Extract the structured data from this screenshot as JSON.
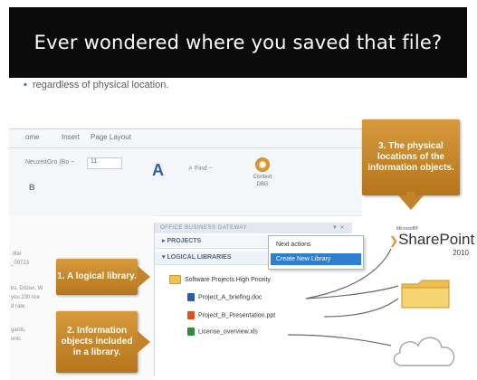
{
  "slide": {
    "title": "Ever wondered where you saved that file?",
    "blurb": "regardless of physical location."
  },
  "ribbon": {
    "tabs": [
      "ome",
      "Insert",
      "Page Layout"
    ],
    "font_name": "NeuzeitGro (Bo ~",
    "font_size": "11",
    "bold": "B",
    "find_label": "Find ~",
    "dbg_label_1": "Context",
    "dbg_label_2": "DBG"
  },
  "doc_text": [
    "itter",
    "_09723",
    "ks, Dozier, W",
    "you 230 lice",
    "d rate.",
    "gards,",
    "onic"
  ],
  "panel": {
    "header": "OFFICE BUSINESS GATEWAY",
    "header_controls": "▼ ✕",
    "projects_label": "PROJECTS",
    "libraries_label": "LOGICAL LIBRARIES",
    "library_name": "Software Projects High Priority",
    "files": [
      {
        "name": "Project_A_briefing.doc",
        "type": "word"
      },
      {
        "name": "Project_B_Presentation.ppt",
        "type": "ppt"
      },
      {
        "name": "License_overview.xls",
        "type": "xls"
      }
    ]
  },
  "context_menu": {
    "items": [
      "Next actions",
      "Create New Library"
    ]
  },
  "callouts": {
    "one": "1. A logical library.",
    "two": "2. Information objects included in a library.",
    "three": "3. The physical locations of the information objects."
  },
  "sharepoint": {
    "ms": "Microsoft®",
    "word": "SharePoint",
    "year": "2010"
  },
  "colors": {
    "callout": "#c2832b",
    "title_bg": "#0b0b0b",
    "menu_highlight": "#2f7fd0"
  }
}
